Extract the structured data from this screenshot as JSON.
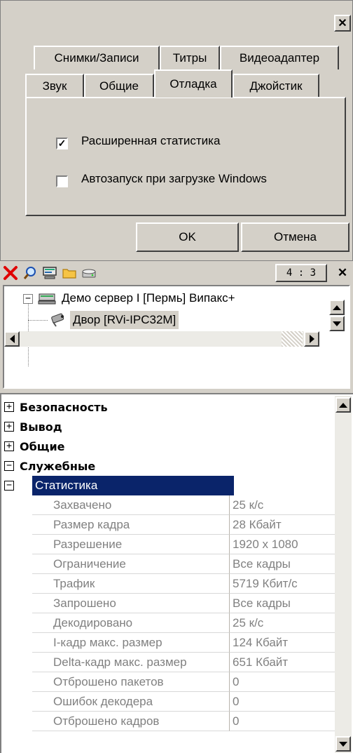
{
  "dialog": {
    "close_glyph": "✕",
    "tabs_row1": [
      "Снимки/Записи",
      "Титры",
      "Видеоадаптер"
    ],
    "tabs_row2": [
      "Звук",
      "Общие",
      "Отладка",
      "Джойстик"
    ],
    "active_tab": "Отладка",
    "checkboxes": [
      {
        "label": "Расширенная статистика",
        "checked": true
      },
      {
        "label": "Автозапуск при загрузке Windows",
        "checked": false
      }
    ],
    "ok_label": "OK",
    "cancel_label": "Отмена"
  },
  "toolbar": {
    "icons": [
      "delete-icon",
      "search-icon",
      "monitor-icon",
      "folder-icon",
      "disk-icon"
    ],
    "aspect_label": "4 : 3",
    "close_glyph": "✕"
  },
  "tree": {
    "server": {
      "expander": "−",
      "label": "Демо сервер I [Пермь] Випакс+"
    },
    "camera": {
      "label": "Двор [RVi-IPC32M]",
      "selected": true
    }
  },
  "grid": {
    "categories": [
      {
        "sign": "+",
        "label": "Безопасность"
      },
      {
        "sign": "+",
        "label": "Вывод"
      },
      {
        "sign": "+",
        "label": "Общие"
      },
      {
        "sign": "−",
        "label": "Служебные"
      }
    ],
    "stats_header": {
      "sign": "−",
      "label": "Статистика"
    },
    "rows": [
      {
        "name": "Захвачено",
        "value": "25 к/с"
      },
      {
        "name": "Размер кадра",
        "value": "28 Кбайт"
      },
      {
        "name": "Разрешение",
        "value": "1920 x 1080"
      },
      {
        "name": "Ограничение",
        "value": "Все кадры"
      },
      {
        "name": "Трафик",
        "value": "5719 Кбит/с"
      },
      {
        "name": "Запрошено",
        "value": "Все кадры"
      },
      {
        "name": "Декодировано",
        "value": "25 к/с"
      },
      {
        "name": "I-кадр макс. размер",
        "value": "124 Кбайт"
      },
      {
        "name": "Delta-кадр макс. размер",
        "value": "651 Кбайт"
      },
      {
        "name": "Отброшено пакетов",
        "value": "0"
      },
      {
        "name": "Ошибок декодера",
        "value": "0"
      },
      {
        "name": "Отброшено кадров",
        "value": "0"
      }
    ]
  },
  "colors": {
    "face": "#d4d0c8",
    "selection": "#0a246a",
    "gray_text": "#808080"
  }
}
